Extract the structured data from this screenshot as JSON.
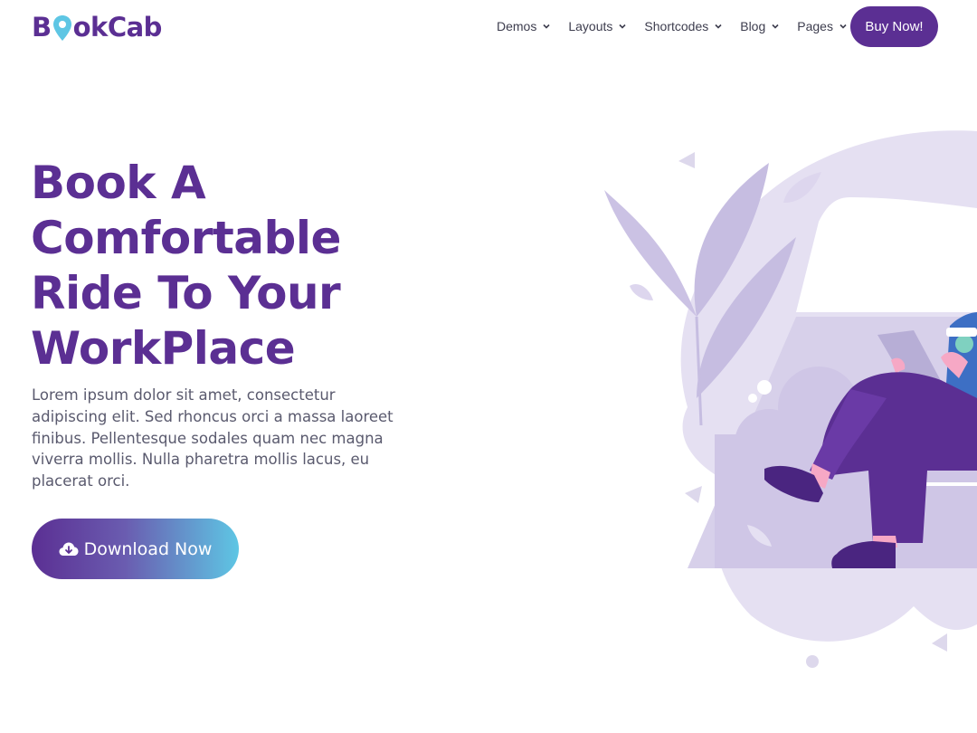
{
  "brand": {
    "name_prefix": "B",
    "name_suffix": "okCab",
    "primary_color": "#5b2f93",
    "accent_color": "#5ec6e4"
  },
  "nav": {
    "items": [
      {
        "label": "Demos"
      },
      {
        "label": "Layouts"
      },
      {
        "label": "Shortcodes"
      },
      {
        "label": "Blog"
      },
      {
        "label": "Pages"
      }
    ],
    "cta_label": "Buy Now!"
  },
  "hero": {
    "title": "Book A Comfortable Ride To Your WorkPlace",
    "description": "Lorem ipsum dolor sit amet, consectetur adipiscing elit. Sed rhoncus orci a massa laoreet finibus. Pellentesque sodales quam nec magna viverra mollis. Nulla pharetra mollis lacus, eu placerat orci.",
    "download_label": "Download Now",
    "download_icon": "cloud-download-icon"
  }
}
